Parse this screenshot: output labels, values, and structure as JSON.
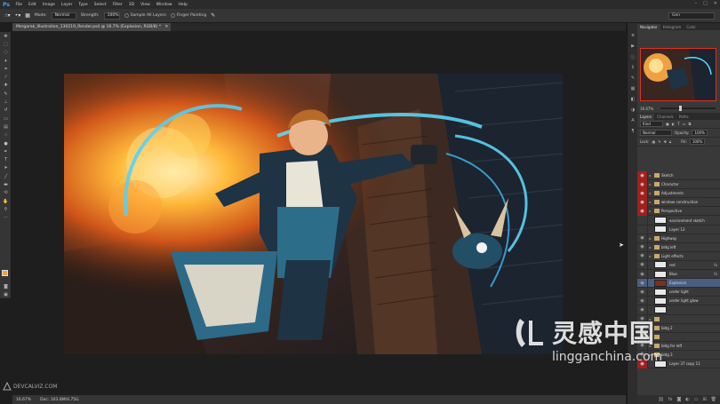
{
  "app": {
    "logo": "Ps"
  },
  "menu": [
    "File",
    "Edit",
    "Image",
    "Layer",
    "Type",
    "Select",
    "Filter",
    "3D",
    "View",
    "Window",
    "Help"
  ],
  "window_controls": {
    "minimize": "–",
    "restore": "□",
    "close": "✕"
  },
  "options_bar": {
    "mode_label": "Mode:",
    "mode_value": "Normal",
    "strength_label": "Strength:",
    "strength_value": "100%",
    "sample_all_layers": "Sample All Layers",
    "finger_painting": "Finger Painting",
    "workspace": "Gen"
  },
  "document": {
    "tab_title": "Mergarak_Illustration_130219_Render.psd @ 16.7% (Explosion, RGB/8) *",
    "tab_close": "✕"
  },
  "status": {
    "zoom": "16.67%",
    "doc_size": "Doc: 103.8M/4.75G"
  },
  "watermark_left": {
    "text": "DEVCALVIZ.COM"
  },
  "navigator": {
    "tabs": [
      "Navigator",
      "Histogram",
      "Color"
    ],
    "zoom": "16.67%",
    "zoom_fraction": 0.35
  },
  "layers_panel": {
    "tabs": [
      "Layers",
      "Channels",
      "Paths"
    ],
    "filter_kind": "Kind",
    "blend_mode": "Normal",
    "opacity_label": "Opacity:",
    "opacity_value": "100%",
    "lock_label": "Lock:",
    "fill_label": "Fill:",
    "fill_value": "100%",
    "layers": [
      {
        "name": "Sketch",
        "kind": "folder",
        "eye": "red"
      },
      {
        "name": "Character",
        "kind": "folder",
        "eye": "red"
      },
      {
        "name": "Adjustments",
        "kind": "folder",
        "eye": "red"
      },
      {
        "name": "window construction",
        "kind": "folder",
        "eye": "red"
      },
      {
        "name": "Perspective",
        "kind": "folder",
        "eye": "red"
      },
      {
        "name": "environment sketch",
        "kind": "layer",
        "eye": "none"
      },
      {
        "name": "Layer 12",
        "kind": "layer",
        "eye": "none"
      },
      {
        "name": "Highway",
        "kind": "folder",
        "eye": "on"
      },
      {
        "name": "bldg left",
        "kind": "folder",
        "eye": "on"
      },
      {
        "name": "Light effects",
        "kind": "folder",
        "eye": "on"
      },
      {
        "name": "red",
        "kind": "layer",
        "eye": "on",
        "fx": "fx"
      },
      {
        "name": "Blue",
        "kind": "layer",
        "eye": "on",
        "fx": "fx"
      },
      {
        "name": "Explosion",
        "kind": "layer",
        "eye": "on",
        "selected": true
      },
      {
        "name": "under light",
        "kind": "layer",
        "eye": "on"
      },
      {
        "name": "under light glow",
        "kind": "layer",
        "eye": "on"
      },
      {
        "name": "",
        "kind": "layer",
        "eye": "on"
      },
      {
        "name": "",
        "kind": "folder",
        "eye": "on"
      },
      {
        "name": "bldg 2",
        "kind": "folder",
        "eye": "on"
      },
      {
        "name": "",
        "kind": "folder",
        "eye": "on"
      },
      {
        "name": "bldg far left",
        "kind": "folder",
        "eye": "on"
      },
      {
        "name": "bldg 3",
        "kind": "folder",
        "eye": "on"
      },
      {
        "name": "Layer 37 copy 11",
        "kind": "layer",
        "eye": "red"
      }
    ]
  },
  "watermark_right": {
    "cn": "灵感中国",
    "url": "lingganchina.com"
  }
}
